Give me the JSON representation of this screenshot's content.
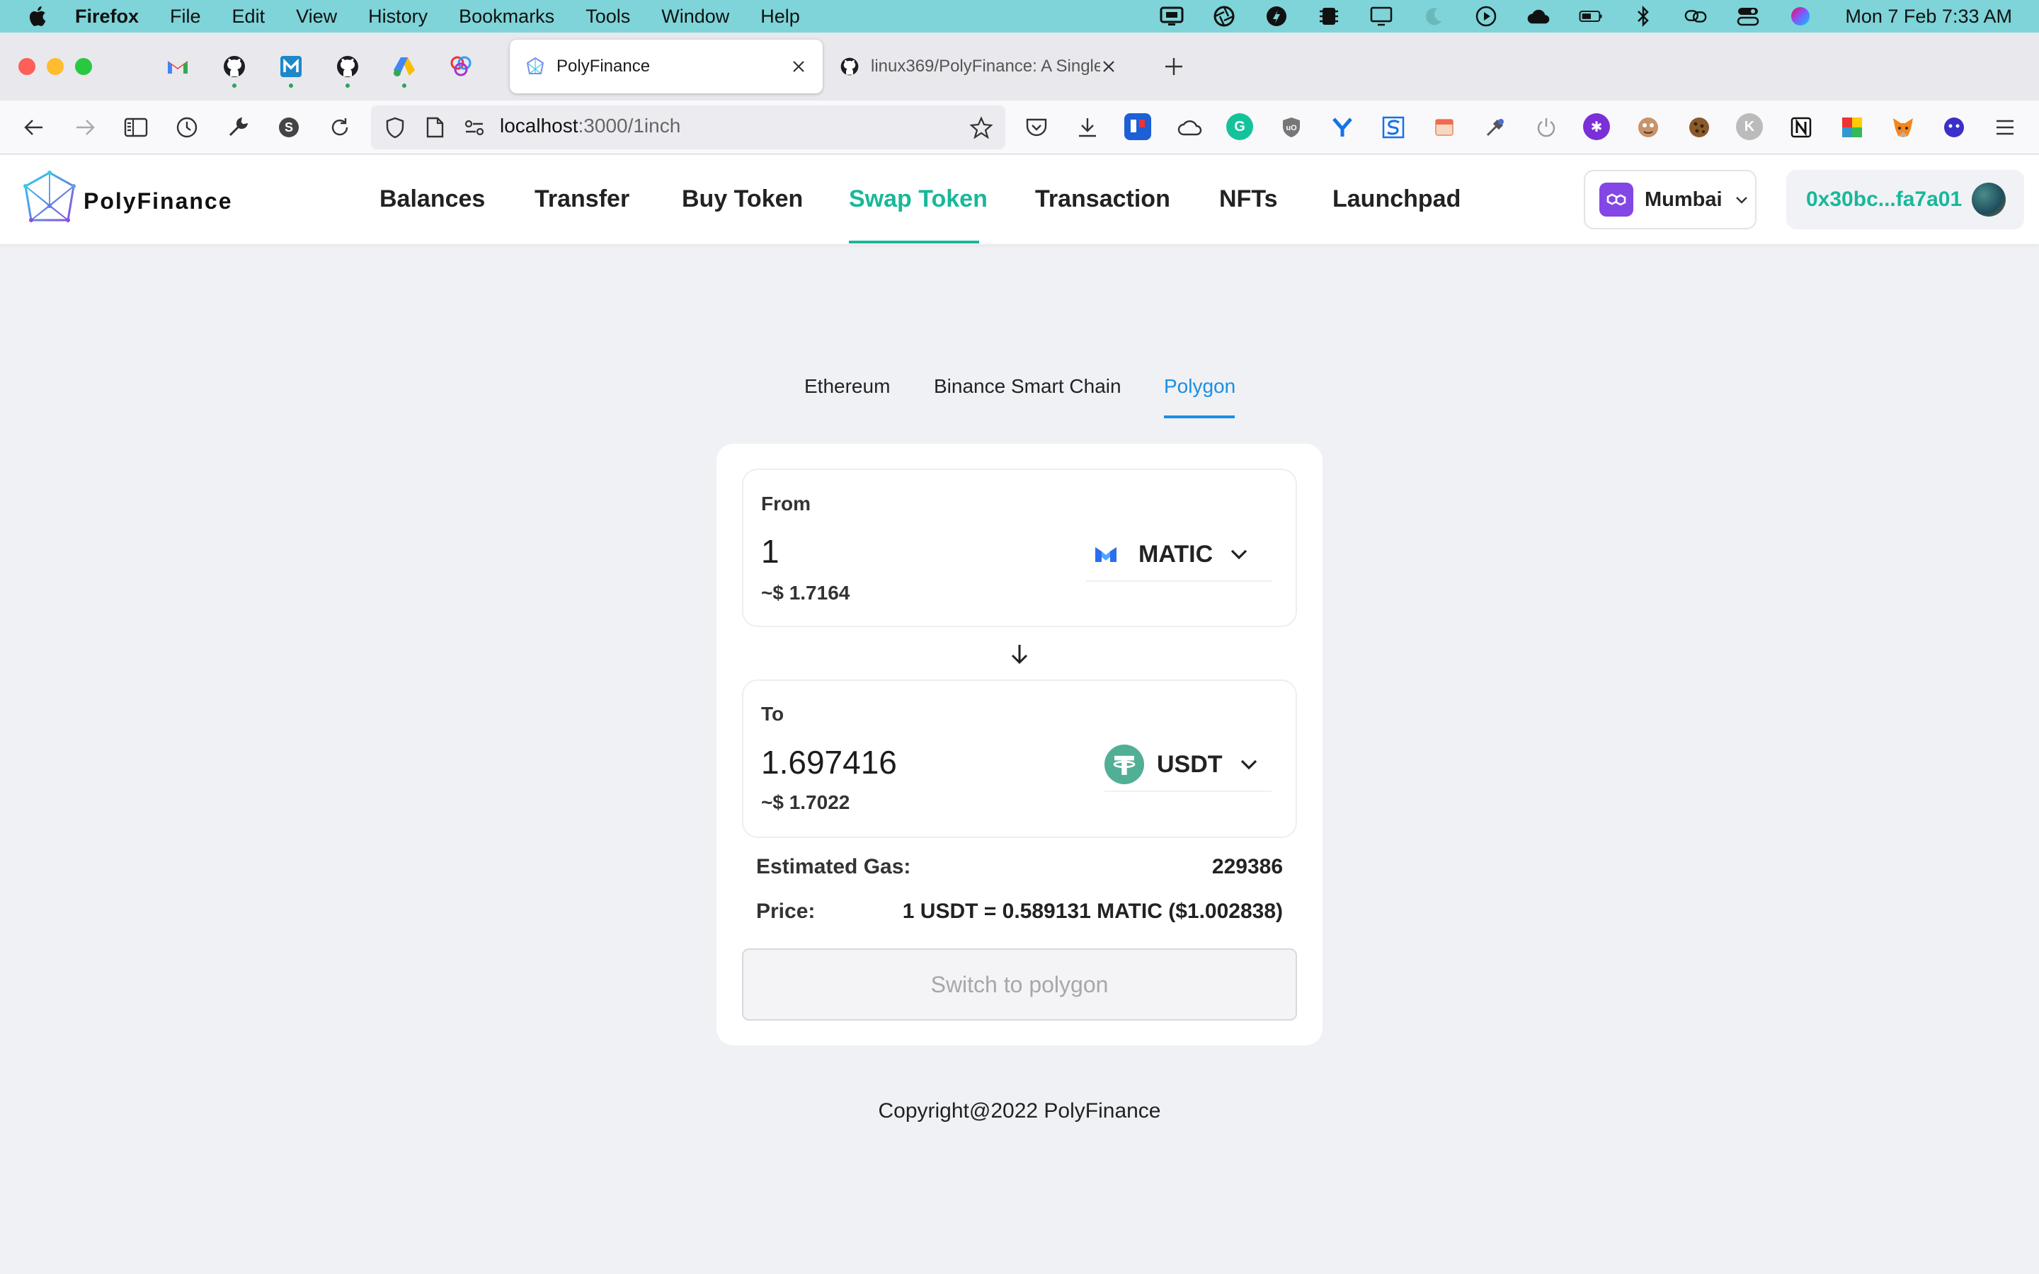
{
  "menubar": {
    "app": "Firefox",
    "items": [
      "File",
      "Edit",
      "View",
      "History",
      "Bookmarks",
      "Tools",
      "Window",
      "Help"
    ],
    "clock": "Mon 7 Feb  7:33 AM"
  },
  "browser": {
    "tabs": [
      {
        "title": "PolyFinance",
        "active": true
      },
      {
        "title": "linux369/PolyFinance: A Single P",
        "active": false
      }
    ],
    "url": {
      "host": "localhost",
      "path": ":3000/1inch"
    }
  },
  "app": {
    "logo": "PolyFinance",
    "nav": [
      "Balances",
      "Transfer",
      "Buy Token",
      "Swap Token",
      "Transaction",
      "NFTs",
      "Launchpad"
    ],
    "active_nav": "Swap Token",
    "network": "Mumbai",
    "account": "0x30bc...fa7a01",
    "accent_color": "#18b89a"
  },
  "chains": {
    "items": [
      "Ethereum",
      "Binance Smart Chain",
      "Polygon"
    ],
    "active": "Polygon"
  },
  "swap": {
    "from": {
      "label": "From",
      "amount": "1",
      "usd": "~$ 1.7164",
      "token": "MATIC"
    },
    "to": {
      "label": "To",
      "amount": "1.697416",
      "usd": "~$ 1.7022",
      "token": "USDT"
    },
    "gas_label": "Estimated Gas:",
    "gas_value": "229386",
    "price_label": "Price:",
    "price_value": "1 USDT = 0.589131 MATIC ($1.002838)",
    "button": "Switch to polygon"
  },
  "footer": {
    "copyright": "Copyright@2022 PolyFinance"
  }
}
